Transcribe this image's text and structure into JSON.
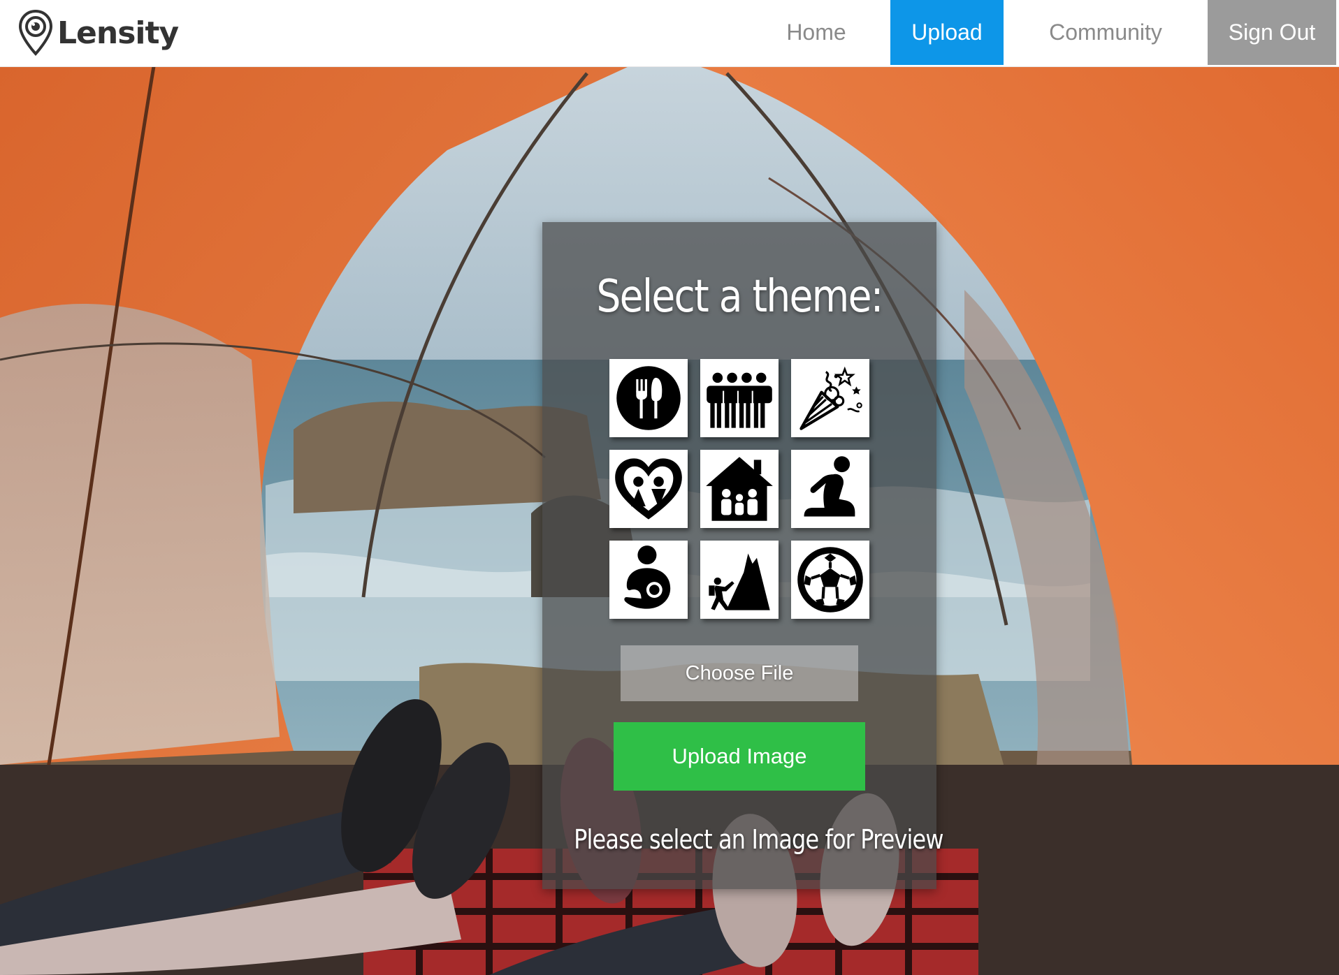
{
  "brand": {
    "name": "Lensity"
  },
  "nav": {
    "home": "Home",
    "upload": "Upload",
    "community": "Community",
    "sign_out": "Sign Out",
    "active": "Upload"
  },
  "panel": {
    "title": "Select a theme:",
    "themes": [
      {
        "icon": "dining-icon"
      },
      {
        "icon": "group-of-people-icon"
      },
      {
        "icon": "party-popper-icon"
      },
      {
        "icon": "couple-heart-icon"
      },
      {
        "icon": "family-house-icon"
      },
      {
        "icon": "kneeling-person-icon"
      },
      {
        "icon": "mother-baby-icon"
      },
      {
        "icon": "mountain-climber-icon"
      },
      {
        "icon": "soccer-ball-icon"
      }
    ],
    "choose_file_label": "Choose File",
    "upload_button_label": "Upload Image",
    "preview_message": "Please select an Image for Preview"
  },
  "colors": {
    "nav_active": "#0d96e8",
    "sign_out_bg": "#9b9b9b",
    "upload_button": "#2fbf47",
    "panel_bg": "rgba(75,75,75,0.72)"
  }
}
